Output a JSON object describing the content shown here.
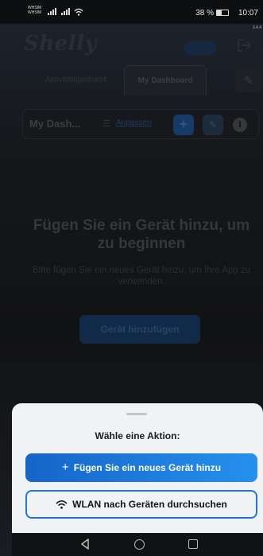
{
  "status_bar": {
    "sim1": "WHSIM",
    "sim2": "WHSIM",
    "battery": "38 %",
    "time": "10:07",
    "version": "3.4.4"
  },
  "app": {
    "logo": "Shelly",
    "tabs": [
      {
        "label": "Aktivitätsprotokoll"
      },
      {
        "label": "My Dashboard"
      }
    ]
  },
  "toolbar": {
    "dashboard_name": "My Dash...",
    "customize_label": "Anpassen"
  },
  "empty_state": {
    "title": "Fügen Sie ein Gerät hinzu, um zu beginnen",
    "description": "Bitte fügen Sie ein neues Gerät hinzu, um Ihre App zu verwenden.",
    "button_label": "Gerät hinzufügen"
  },
  "action_sheet": {
    "title": "Wähle eine Aktion:",
    "primary_action": "Fügen Sie ein neues Gerät hinzu",
    "secondary_action": "WLAN nach Geräten durchsuchen"
  },
  "colors": {
    "accent": "#1d77d8",
    "sheet_background": "#f1f2f4"
  },
  "icons": [
    "signal-icon",
    "wifi-icon",
    "battery-icon",
    "logout-icon",
    "pencil-icon",
    "sliders-icon",
    "plus-icon",
    "info-icon",
    "back-icon",
    "home-icon",
    "recents-icon"
  ]
}
